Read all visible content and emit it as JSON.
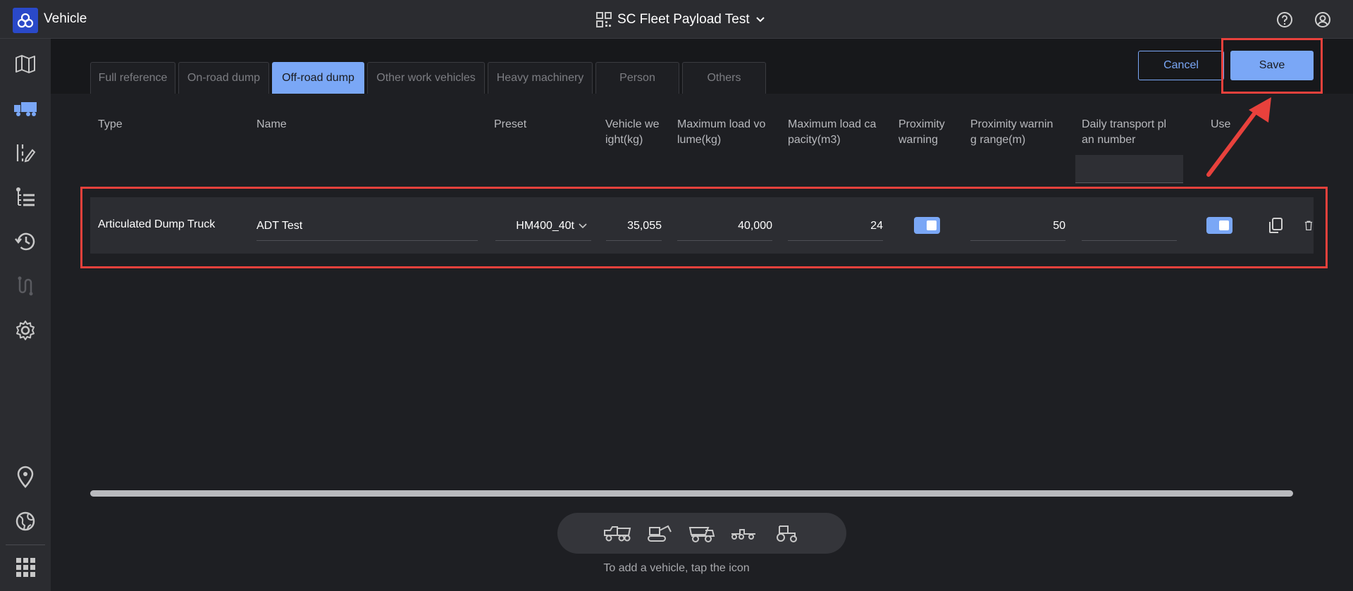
{
  "app": {
    "title": "Vehicle"
  },
  "project": {
    "name": "SC Fleet Payload Test"
  },
  "tabs": [
    {
      "label": "Full reference"
    },
    {
      "label": "On-road dump"
    },
    {
      "label": "Off-road dump",
      "active": true
    },
    {
      "label": "Other work vehicles"
    },
    {
      "label": "Heavy machinery"
    },
    {
      "label": "Person"
    },
    {
      "label": "Others"
    }
  ],
  "actions": {
    "cancel_label": "Cancel",
    "save_label": "Save"
  },
  "table": {
    "headers": {
      "type": "Type",
      "name": "Name",
      "preset": "Preset",
      "vehicle_weight_1": "Vehicle we",
      "vehicle_weight_2": "ight(kg)",
      "max_volume_1": "Maximum load vo",
      "max_volume_2": "lume(kg)",
      "max_capacity_1": "Maximum load ca",
      "max_capacity_2": "pacity(m3)",
      "proximity_1": "Proximity",
      "proximity_2": "warning",
      "prox_range_1": "Proximity warnin",
      "prox_range_2": "g range(m)",
      "daily_1": "Daily transport pl",
      "daily_2": "an number",
      "use": "Use"
    },
    "rows": [
      {
        "type": "Articulated Dump Truck",
        "name": "ADT Test",
        "preset": "HM400_40t",
        "vehicle_weight": "35,055",
        "max_volume": "40,000",
        "max_capacity": "24",
        "proximity_warning": true,
        "proximity_range": "50",
        "daily_transport": "",
        "use": true
      }
    ]
  },
  "add_vehicle": {
    "hint": "To add a vehicle, tap the icon"
  },
  "colors": {
    "accent": "#7aa7f6",
    "highlight": "#e8413c",
    "background": "#1e1f23"
  }
}
